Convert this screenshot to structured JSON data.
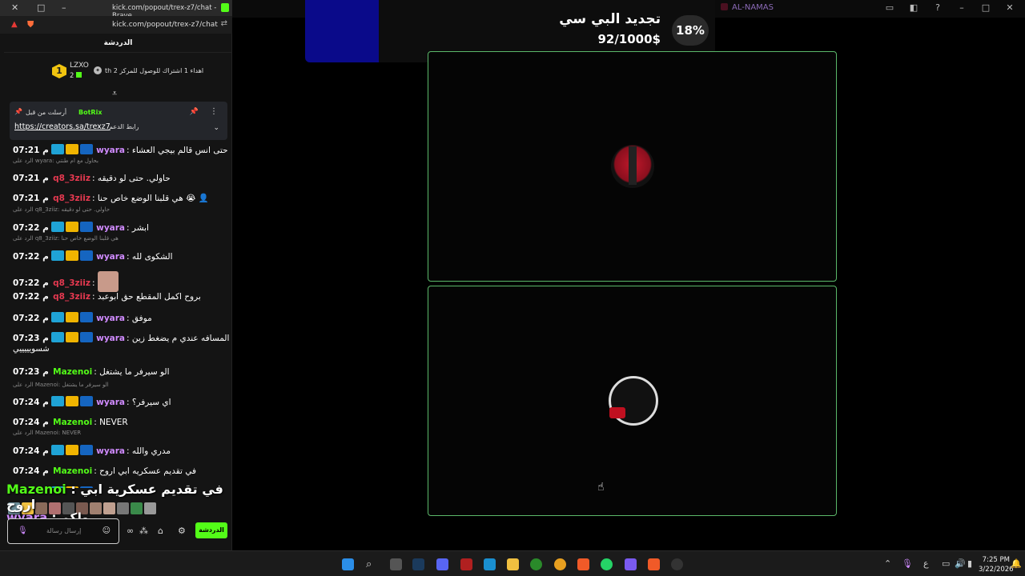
{
  "window": {
    "stream_title": "AL-NAMAS"
  },
  "browser": {
    "title": "kick.com/popout/trex-z7/chat - Brave",
    "url": "kick.com/popout/trex-z7/chat"
  },
  "chat": {
    "header": "الدردشة",
    "leaderboard": {
      "rank": "1",
      "username": "LZXO",
      "count": "2",
      "gift_text": "th اهداء 1 اشتراك للوصول للمركز 2"
    },
    "pinned": {
      "sent_by_label": "أرسلت من قبل",
      "bot_name": "BotRix",
      "link": "https://creators.sa/trexz7",
      "link_label": "رابط الدعم"
    },
    "messages": [
      {
        "time": "07:21 م",
        "user": "wyara",
        "text": "حتى انس قالم بيجي العشاء"
      },
      {
        "time": "07:21 م",
        "user": "q8_3ziiz",
        "text": "حاولي. حتى لو دقيقه",
        "reply": "الرد على wyara: بحاول مع ام طنتي"
      },
      {
        "time": "07:21 م",
        "user": "q8_3ziiz",
        "text": "هي قلبنا الوضع خاص حنا 😭 👤"
      },
      {
        "time": "07:22 م",
        "user": "wyara",
        "text": "ابشر",
        "reply": "الرد على q8_3ziiz: حاولي. حتى لو دقيقه"
      },
      {
        "time": "07:22 م",
        "user": "wyara",
        "text": "الشكوى لله",
        "reply": "الرد على q8_3ziiz: هي قلبنا الوضع خاص حنا"
      },
      {
        "time": "07:22 م",
        "user": "q8_3ziiz",
        "text": ""
      },
      {
        "time": "07:22 م",
        "user": "q8_3ziiz",
        "text": "بروح اكمل المقطع حق ابوعبد"
      },
      {
        "time": "07:22 م",
        "user": "wyara",
        "text": "موفق"
      },
      {
        "time": "07:23 م",
        "user": "wyara",
        "text": "المسافه عندي م يضغط زين",
        "text2": "شسويييييي"
      },
      {
        "time": "07:23 م",
        "user": "Mazenoi",
        "text": "الو سيرفر ما يشتغل"
      },
      {
        "time": "07:24 م",
        "user": "wyara",
        "text": "اي سيرفر؟",
        "reply": "الرد على Mazenoi: الو سيرفر ما يشتغل"
      },
      {
        "time": "07:24 م",
        "user": "Mazenoi",
        "text": "NEVER"
      },
      {
        "time": "07:24 م",
        "user": "wyara",
        "text": "مدري والله",
        "reply": "الرد على Mazenoi: NEVER"
      },
      {
        "time": "07:24 م",
        "user": "Mazenoi",
        "text": "في تقديم عسكريه ابي اروح"
      },
      {
        "time": "07:25 م",
        "user": "wyara",
        "text": "لكم"
      }
    ],
    "overlay": {
      "line1_user": "Mazenoi",
      "line1_text": "في تقديم عسكرية ابي اروح",
      "line2_user": "wyara",
      "line2_text": "ولكم"
    },
    "input_placeholder": "إرسال رسالة",
    "send_label": "الدردشة"
  },
  "goal": {
    "title": "تجديد البي سي",
    "value": "92/1000$",
    "percent": "18%"
  },
  "taskbar": {
    "time": "7:25 PM",
    "date": "3/22/2026",
    "lang": "ع"
  },
  "colors": {
    "kick_green": "#53fc18",
    "wyara": "#d08bff",
    "q8_3ziiz": "#e53950",
    "Mazenoi": "#53fc18",
    "cam_border": "#5bb86a",
    "goal_blue": "#0a0a8a"
  }
}
